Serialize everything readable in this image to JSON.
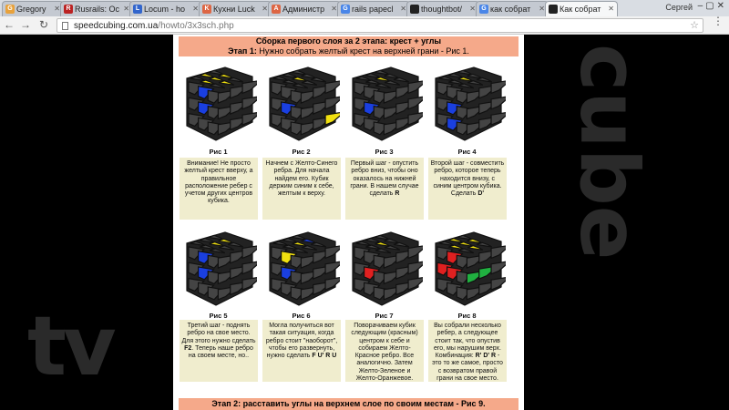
{
  "browser": {
    "tabs": [
      {
        "label": "Gregory",
        "fav": "G",
        "color": "#e8a23c"
      },
      {
        "label": "Rusrails: Ос",
        "fav": "R",
        "color": "#b22"
      },
      {
        "label": "Locum - ho",
        "fav": "L",
        "color": "#3366cc"
      },
      {
        "label": "Кухни Luck",
        "fav": "K",
        "color": "#d64"
      },
      {
        "label": "Администр",
        "fav": "A",
        "color": "#d64"
      },
      {
        "label": "rails papecl",
        "fav": "G",
        "color": "#4a86e8"
      },
      {
        "label": "thoughtbot/",
        "fav": "",
        "color": "#222"
      },
      {
        "label": "как собрат",
        "fav": "G",
        "color": "#4a86e8"
      },
      {
        "label": "Как собрат",
        "fav": "",
        "color": "#222"
      }
    ],
    "user": "Сергей",
    "url_host": "speedcubing.com.ua",
    "url_path": "/howto/3x3sch.php"
  },
  "page": {
    "header_title": "Сборка первого слоя за 2 этапа: крест + углы",
    "header_stage": "Этап 1:",
    "header_desc": " Нужно собрать желтый крест на верхней грани - Рис 1.",
    "footer": "Этап 2: расставить углы на верхнем слое по своим местам - Рис 9."
  },
  "figures": [
    {
      "caption": "Рис 1",
      "text": "Внимание! Не просто желтый крест вверху, а правильное расположение ребер с учетом других центров кубика.",
      "bold": ""
    },
    {
      "caption": "Рис 2",
      "text": "Начнем с Желто-Синего ребра. Для начала найдем его. Кубик держим синим к себе, желтым к верху.",
      "bold": ""
    },
    {
      "caption": "Рис 3",
      "text": "Первый шаг - опустить ребро вниз, чтобы оно оказалось на нижней грани. В нашем случае сделать",
      "bold": "R"
    },
    {
      "caption": "Рис 4",
      "text": "Второй шаг - совместить ребро, которое теперь находится внизу, с синим центром кубика. Сделать",
      "bold": "D'"
    },
    {
      "caption": "Рис 5",
      "text": "Третий шаг - поднять ребро на свое место. Для этого нужно сделать",
      "bold": "F2",
      "after": ". Теперь наше ребро на своем месте, но.."
    },
    {
      "caption": "Рис 6",
      "text": "Могла получиться вот такая ситуация, когда ребро стоит \"наоборот\", чтобы его развернуть, нужно сделать",
      "bold": "F U' R U"
    },
    {
      "caption": "Рис 7",
      "text": "Поворачиваем кубик следующим (красным) центром к себе и собираем Желто-Красное ребро. Все аналогично. Затем Желто-Зеленое и Желто-Оранжевое.",
      "bold": ""
    },
    {
      "caption": "Рис 8",
      "text": "Вы собрали несколько ребер, а следующее стоит так, что опустив его, мы нарушим верх. Комбинация:",
      "bold": "R' D' R",
      "after": " - это то же самое, просто с возвратом правой грани на свое место."
    }
  ],
  "background": {
    "left": "tv",
    "right": "cube"
  },
  "colors": {
    "yellow": "#f0e010",
    "blue": "#1a3fe0",
    "red": "#e02020",
    "green": "#20b040",
    "dark": "#444444",
    "header": "#f5a98a",
    "desc_bg": "#f0edce"
  }
}
